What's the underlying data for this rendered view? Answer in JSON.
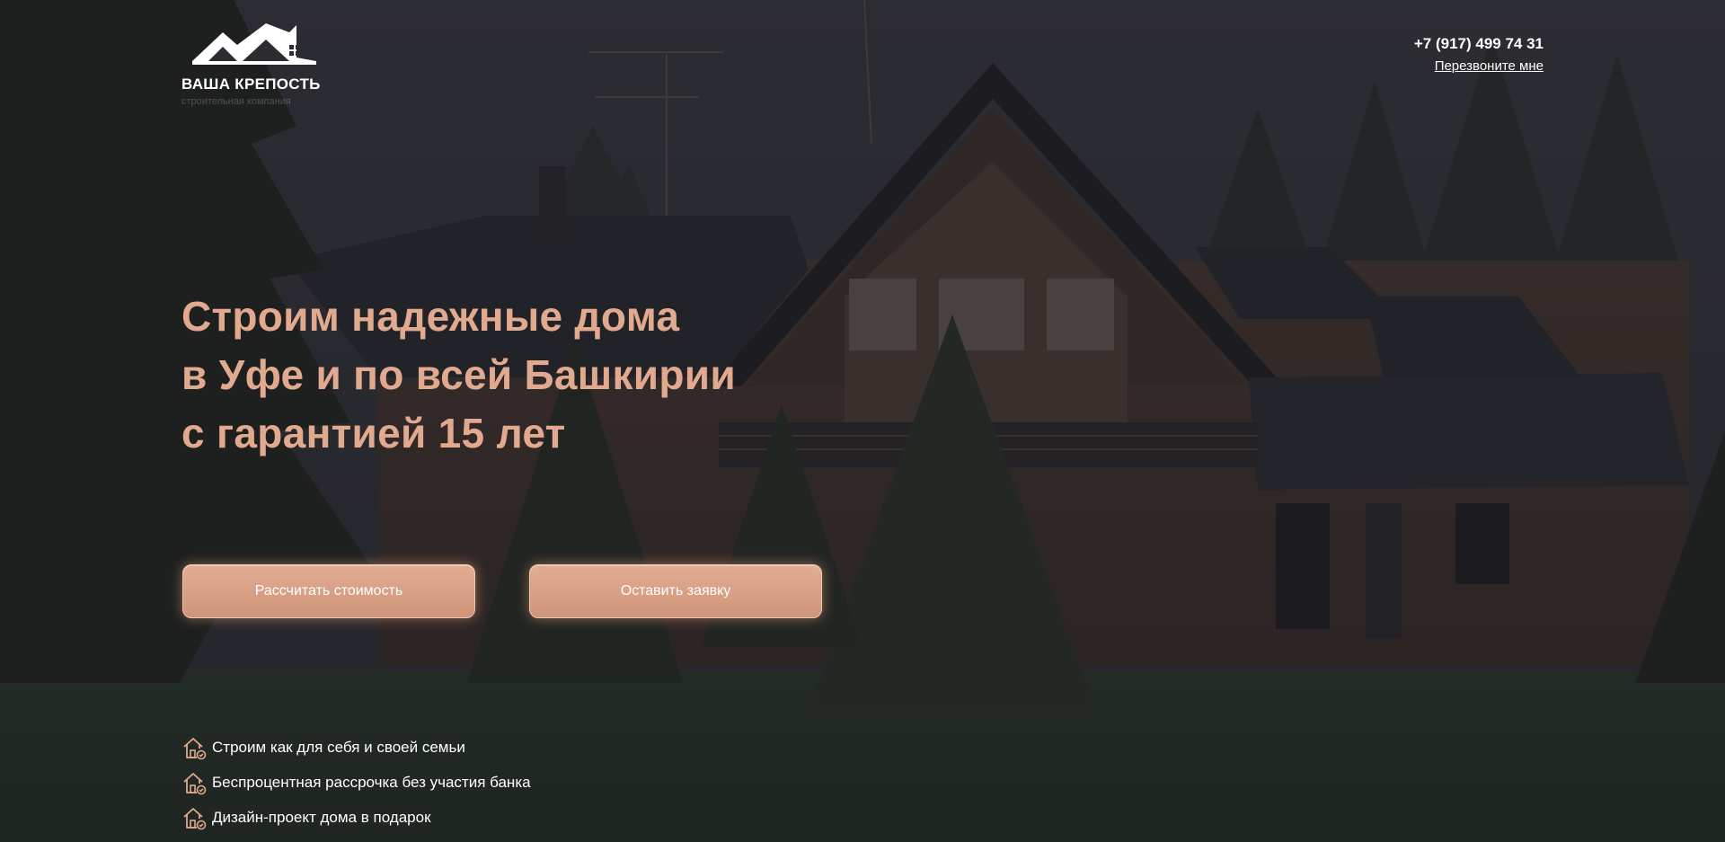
{
  "brand": {
    "name": "ВАША КРЕПОСТЬ",
    "tagline": "строительная компания"
  },
  "contacts": {
    "phone": "+7 (917) 499 74 31",
    "callback_label": "Перезвоните мне"
  },
  "hero": {
    "title_lines": [
      "Строим надежные дома",
      "в Уфе и по всей Башкирии",
      "с гарантией 15 лет"
    ]
  },
  "buttons": {
    "calculate": "Рассчитать стоимость",
    "order": "Оставить заявку"
  },
  "features": [
    {
      "text": "Строим как для себя и своей семьи",
      "icon": "house-check-icon"
    },
    {
      "text": "Беспроцентная рассрочка без участия банка",
      "icon": "house-check-icon"
    },
    {
      "text": "Дизайн-проект дома в подарок",
      "icon": "house-check-icon"
    }
  ],
  "colors": {
    "accent": "#e1aa8f",
    "button": "#d99e82",
    "text": "#ffffff"
  }
}
